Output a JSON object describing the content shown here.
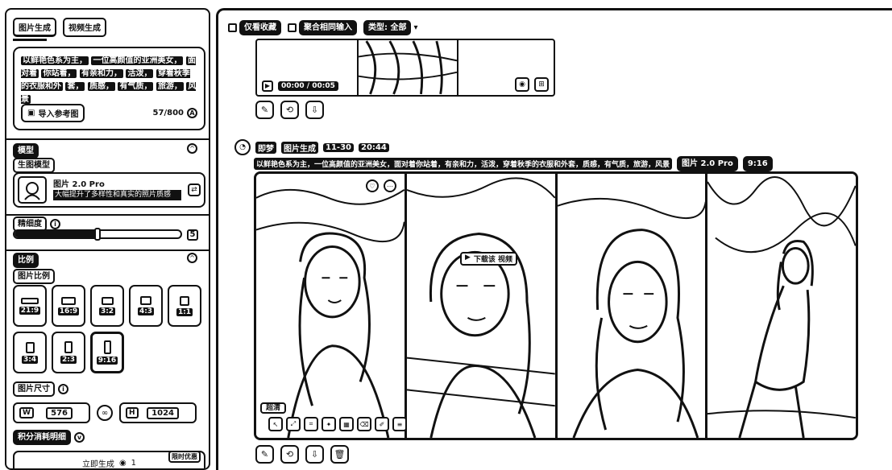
{
  "tabs": [
    {
      "label": "图片生成",
      "active": true
    },
    {
      "label": "视频生成",
      "active": false
    }
  ],
  "prompt": {
    "segments": [
      "以鲜艳色系为主，",
      "一位高颜值的亚洲美女，",
      "面对着",
      "你站着，",
      "有亲和力，",
      "活泼，",
      "穿着秋季的衣服和外",
      "套，",
      "质感，",
      "有气质，",
      "旅游，",
      "风景"
    ],
    "upload_label": "导入参考图",
    "char_count": "57/800"
  },
  "model_section": {
    "title": "模型",
    "sub": "生图模型",
    "model_name": "图片 2.0 Pro",
    "model_desc": "大幅提升了多样性和真实的照片质感"
  },
  "detail": {
    "label": "精细度",
    "value": "5",
    "level_fraction": 0.5
  },
  "ratio_section": {
    "title": "比例",
    "sub": "图片比例",
    "options": [
      {
        "label": "21:9",
        "selected": false
      },
      {
        "label": "16:9",
        "selected": false
      },
      {
        "label": "3:2",
        "selected": false
      },
      {
        "label": "4:3",
        "selected": false
      },
      {
        "label": "1:1",
        "selected": false
      },
      {
        "label": "3:4",
        "selected": false
      },
      {
        "label": "2:3",
        "selected": false
      },
      {
        "label": "9:16",
        "selected": true
      }
    ]
  },
  "size": {
    "label": "图片尺寸",
    "w_key": "W",
    "w_value": "576",
    "h_key": "H",
    "h_value": "1024"
  },
  "cost": {
    "label": "积分消耗明细"
  },
  "generate": {
    "label": "立即生成",
    "cost": "1",
    "badge": "限时优惠"
  },
  "filters": {
    "favorite": "仅看收藏",
    "merge": "聚合相同输入",
    "type": "类型: 全部"
  },
  "video": {
    "time": "00:00 / 00:05"
  },
  "record": {
    "app": "即梦",
    "type": "图片生成",
    "date": "11-30",
    "time": "20:44",
    "prompt": "以鲜艳色系为主，一位高颜值的亚洲美女，面对着你站着，有亲和力，活泼，穿着秋季的衣服和外套，质感，有气质，旅游，风景",
    "model_tag": "图片 2.0 Pro",
    "ratio_tag": "9:16"
  },
  "overlay": {
    "tip": "下载该 视频",
    "hd": "超清"
  }
}
